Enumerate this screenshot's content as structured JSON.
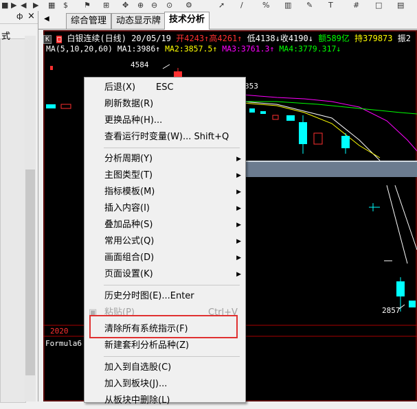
{
  "left_panel": {
    "text": "式",
    "pin": "ф",
    "close": "×"
  },
  "tabs": [
    {
      "label": "综合管理"
    },
    {
      "label": "动态显示牌"
    },
    {
      "label": "技术分析"
    }
  ],
  "quote": {
    "k_badge": "K",
    "title": "白银连续(日线) 20/05/19",
    "open": "开4243↑",
    "high": "高4261↑",
    "low": "低4138↓",
    "close": "收4190↓",
    "amount": "额589亿",
    "hold": "持379873",
    "amp": "振2"
  },
  "ma": {
    "label": "MA(5,10,20,60)",
    "ma1": "MA1:3986↑",
    "ma2": "MA2:3857.5↑",
    "ma3": "MA3:3761.3↑",
    "ma4": "MA4:3779.317↓"
  },
  "chart_labels": {
    "high_price": "4584",
    "mid_price": "353",
    "low_price": "2857",
    "year": "2020",
    "formula": "Formula6"
  },
  "menu": {
    "items": [
      {
        "label": "后退(X)",
        "shortcut": "ESC"
      },
      {
        "label": "刷新数据(R)"
      },
      {
        "label": "更换品种(H)..."
      },
      {
        "label": "查看运行时变量(W)... Shift+Q"
      },
      {
        "label": "分析周期(Y)"
      },
      {
        "label": "主图类型(T)"
      },
      {
        "label": "指标模板(M)"
      },
      {
        "label": "插入内容(I)"
      },
      {
        "label": "叠加品种(S)"
      },
      {
        "label": "常用公式(Q)"
      },
      {
        "label": "画面组合(D)"
      },
      {
        "label": "页面设置(K)"
      },
      {
        "label": "历史分时图(E)...Enter"
      },
      {
        "label": "粘贴(P)",
        "shortcut": "Ctrl+V"
      },
      {
        "label": "清除所有系统指示(F)"
      },
      {
        "label": "新建套利分析品种(Z)"
      },
      {
        "label": "加入到自选股(C)"
      },
      {
        "label": "加入到板块(J)..."
      },
      {
        "label": "从板块中删除(L)"
      }
    ],
    "submenu_arrow": "▶"
  },
  "colors": {
    "chart_bg": "#000000",
    "up": "#ff3030",
    "down": "#00ffff",
    "ma1": "#ffffff",
    "ma2": "#ffff00",
    "ma3": "#ff00ff",
    "ma4": "#00ff00",
    "highlight": "#e03030"
  }
}
